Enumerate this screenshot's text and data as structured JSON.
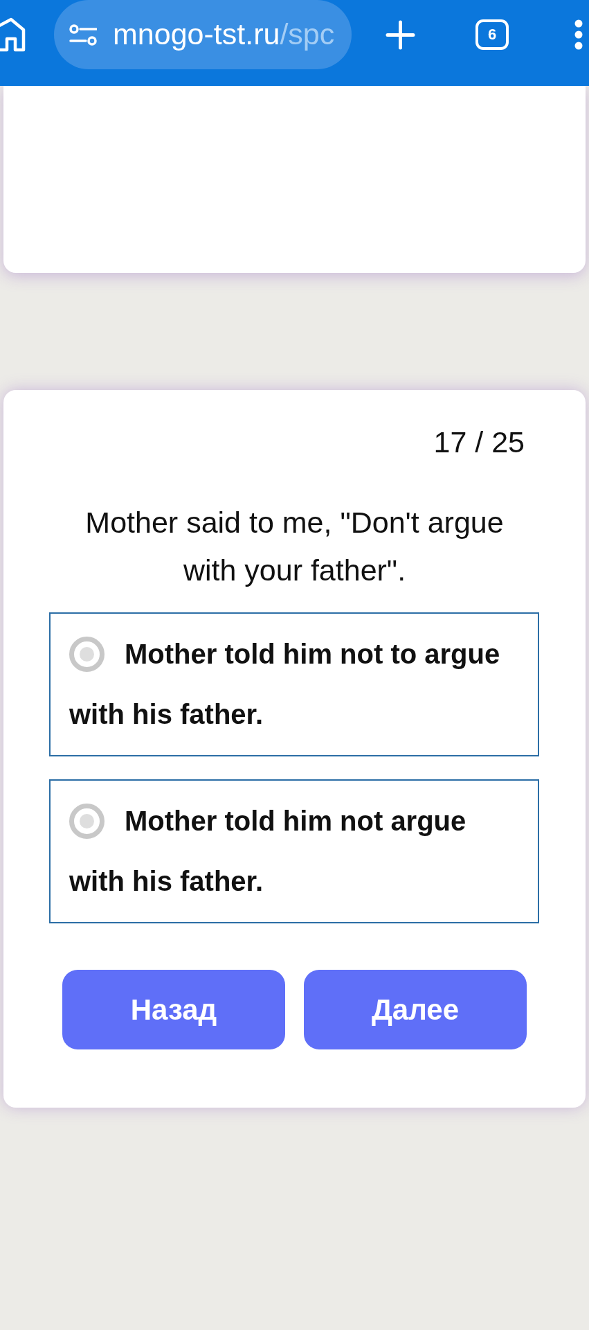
{
  "browser_bar": {
    "url_host": "mnogo-tst.ru",
    "url_path": "/spc",
    "tab_count": "6"
  },
  "quiz": {
    "progress": "17 / 25",
    "question": "Mother said to me, \"Don't argue with your father\".",
    "options": [
      {
        "text": "Mother told him not to argue with his father.",
        "selected": false
      },
      {
        "text": "Mother told him not argue with his father.",
        "selected": false
      }
    ],
    "buttons": [
      "Назад",
      "Далее"
    ]
  }
}
